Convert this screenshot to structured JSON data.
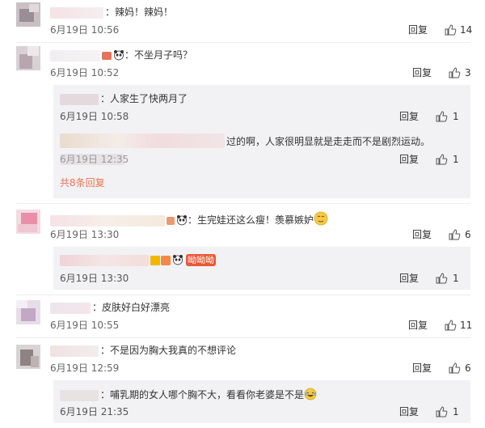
{
  "reply_label": "回复",
  "more_replies": "共8条回复",
  "comments": [
    {
      "text": "：辣妈！辣妈！",
      "time": "6月19日 10:56",
      "likes": "14"
    },
    {
      "text": "：不坐月子吗？",
      "time": "6月19日 10:52",
      "likes": "3",
      "replies": [
        {
          "text": "：人家生了快两月了",
          "time": "6月19日 10:58",
          "likes": "1"
        },
        {
          "text": "过的啊，人家很明显就是走走而不是剧烈运动。",
          "time": "6月19日 12:35",
          "likes": "1"
        }
      ]
    },
    {
      "text": "：生完娃还这么瘦！羡慕嫉妒",
      "time": "6月19日 13:30",
      "likes": "6",
      "replies": [
        {
          "text": "",
          "time": "6月19日 13:30",
          "likes": "1",
          "sticker": "呦呦呦"
        }
      ]
    },
    {
      "text": "：皮肤好白好漂亮",
      "time": "6月19日 10:55",
      "likes": "11"
    },
    {
      "text": "：不是因为胸大我真的不想评论",
      "time": "6月19日 12:59",
      "likes": "6",
      "replies": [
        {
          "text": "：哺乳期的女人哪个胸不大，看看你老婆是不是",
          "time": "6月19日 21:35",
          "likes": "1"
        }
      ]
    }
  ],
  "icons": {
    "like": "thumbs-up-icon",
    "emoji_panda": "panda-emoji-icon",
    "emoji_envy": "envy-emoji-icon",
    "emoji_laugh": "laugh-cry-emoji-icon",
    "vip": "vip-badge-icon"
  },
  "colors": {
    "panel_bg": "#f2f2f5",
    "more_link": "#eb7350",
    "meta": "#666666"
  }
}
